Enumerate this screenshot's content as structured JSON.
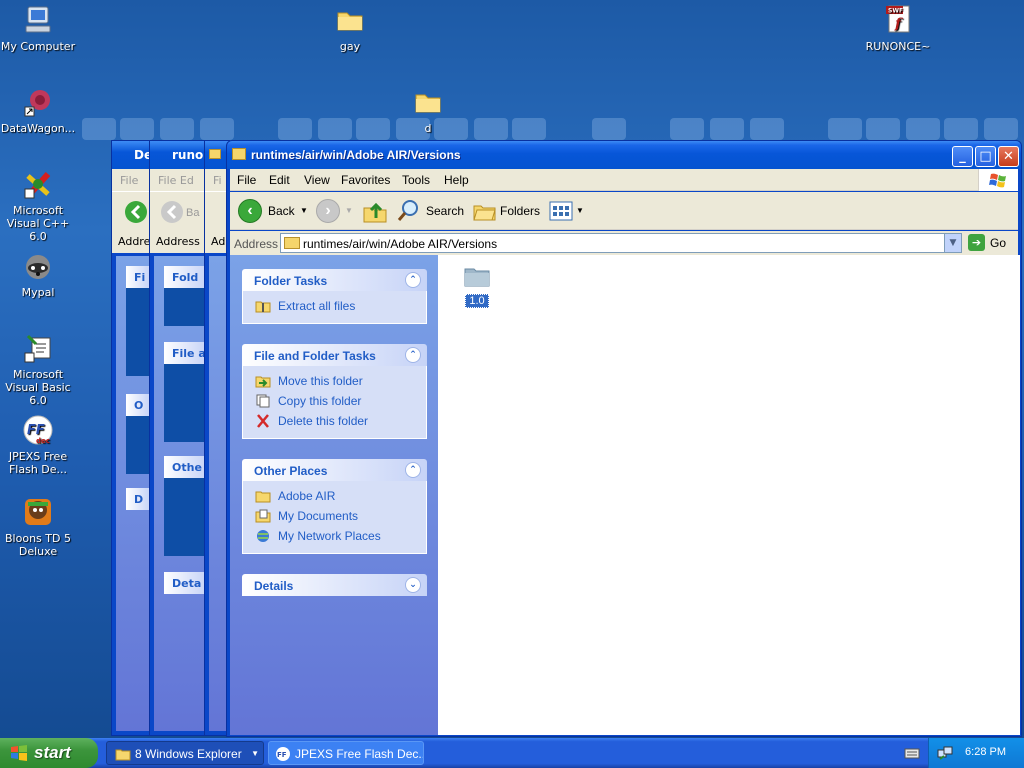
{
  "desktop": {
    "icons": [
      {
        "label": "My Computer",
        "icon": "my-computer-icon"
      },
      {
        "label": "gay",
        "icon": "folder-icon"
      },
      {
        "label": "RUNONCE~",
        "icon": "swf-file-icon"
      },
      {
        "label": "DataWagon...",
        "icon": "datawagon-shortcut-icon"
      },
      {
        "label": "d",
        "icon": "folder-icon"
      },
      {
        "label": "Microsoft Visual C++ 6.0",
        "icon": "visual-cpp-icon"
      },
      {
        "label": "Mypal",
        "icon": "mypal-raccoon-icon"
      },
      {
        "label": "Microsoft Visual Basic 6.0",
        "icon": "visual-basic-icon"
      },
      {
        "label": "JPEXS Free Flash De...",
        "icon": "jpexs-ffdec-icon"
      },
      {
        "label": "Bloons TD 5 Deluxe",
        "icon": "bloons-icon"
      }
    ],
    "swf_badge": "SWF"
  },
  "bg_windows": [
    {
      "title": "De",
      "menu": "File",
      "address": "Addre",
      "panels": [
        "Fi",
        "O",
        "D"
      ]
    },
    {
      "title": "runor",
      "menu": "File   Ed",
      "back": "Ba",
      "address": "Address",
      "panels": [
        "Fold",
        "File a",
        "Othe",
        "Deta"
      ]
    },
    {
      "title": "",
      "menu": "Fi",
      "address": "Ad",
      "panels": []
    }
  ],
  "window": {
    "title": "runtimes/air/win/Adobe AIR/Versions",
    "controls": {
      "minimize": "_",
      "maximize": "□",
      "close": "✕"
    },
    "menu": [
      "File",
      "Edit",
      "View",
      "Favorites",
      "Tools",
      "Help"
    ],
    "toolbar": {
      "back": "Back",
      "search": "Search",
      "folders": "Folders"
    },
    "address": {
      "label": "Address",
      "value": "runtimes/air/win/Adobe AIR/Versions",
      "go": "Go"
    },
    "panels": {
      "folder_tasks": {
        "title": "Folder Tasks",
        "items": [
          {
            "label": "Extract all files",
            "icon": "extract-zip-icon"
          }
        ]
      },
      "file_folder_tasks": {
        "title": "File and Folder Tasks",
        "items": [
          {
            "label": "Move this folder",
            "icon": "move-folder-icon"
          },
          {
            "label": "Copy this folder",
            "icon": "copy-folder-icon"
          },
          {
            "label": "Delete this folder",
            "icon": "delete-x-icon"
          }
        ]
      },
      "other_places": {
        "title": "Other Places",
        "items": [
          {
            "label": "Adobe AIR",
            "icon": "folder-icon"
          },
          {
            "label": "My Documents",
            "icon": "my-documents-icon"
          },
          {
            "label": "My Network Places",
            "icon": "network-places-icon"
          }
        ]
      },
      "details": {
        "title": "Details"
      }
    },
    "content": {
      "items": [
        {
          "label": "1.0",
          "icon": "zip-folder-icon"
        }
      ]
    }
  },
  "taskbar": {
    "start": "start",
    "buttons": [
      {
        "label": "8 Windows Explorer",
        "icon": "folder-group-icon"
      },
      {
        "label": "JPEXS Free Flash Dec...",
        "icon": "jpexs-ffdec-icon"
      }
    ],
    "clock": "6:28 PM",
    "colors": {
      "start_green": "#3c953c",
      "taskbar_blue": "#245edb"
    }
  }
}
